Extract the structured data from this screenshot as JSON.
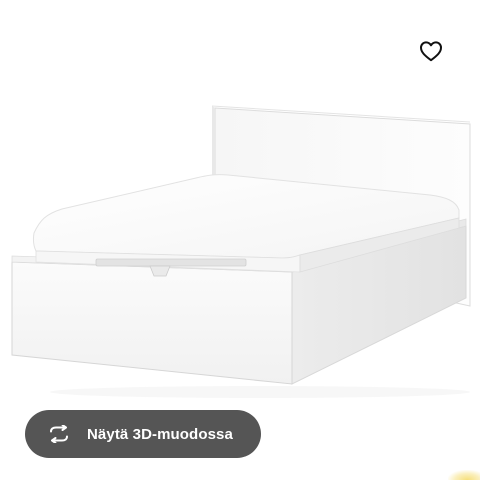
{
  "product": {
    "image_alt": "MALM bed frame with storage, white",
    "favourite_icon": "heart-outline-icon",
    "view_3d": {
      "label": "Näytä 3D-muodossa",
      "icon": "rotate-3d-icon"
    }
  },
  "colors": {
    "button_bg": "#555555",
    "button_text": "#ffffff",
    "icon": "#111111",
    "bed_white": "#f9f9f9"
  }
}
